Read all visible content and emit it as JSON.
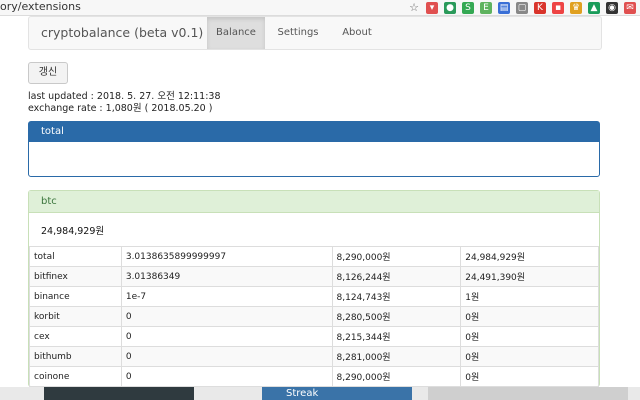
{
  "browser": {
    "url_fragment": "ory/extensions",
    "icons": [
      {
        "name": "star-icon",
        "color": "#666666",
        "glyph": "☆"
      },
      {
        "name": "pocket-icon",
        "color": "#e05050",
        "glyph": "▾"
      },
      {
        "name": "chat-icon",
        "color": "#2a9a5a",
        "glyph": "●"
      },
      {
        "name": "extension-icon",
        "color": "#34a853",
        "glyph": "S"
      },
      {
        "name": "evernote-icon",
        "color": "#5fb35f",
        "glyph": "E"
      },
      {
        "name": "doc-icon",
        "color": "#3a6fd6",
        "glyph": "▤"
      },
      {
        "name": "outline-icon",
        "color": "#888888",
        "glyph": "▢"
      },
      {
        "name": "k-icon",
        "color": "#d9342b",
        "glyph": "K"
      },
      {
        "name": "red-block-icon",
        "color": "#e44",
        "glyph": "▪"
      },
      {
        "name": "crown-icon",
        "color": "#e0a020",
        "glyph": "♛"
      },
      {
        "name": "drive-icon",
        "color": "#1a9c5a",
        "glyph": "▲"
      },
      {
        "name": "github-icon",
        "color": "#333333",
        "glyph": "◉"
      },
      {
        "name": "mail-icon",
        "color": "#e05050",
        "glyph": "✉"
      }
    ]
  },
  "navbar": {
    "brand": "cryptobalance (beta v0.1)",
    "tabs": [
      {
        "label": "Balance",
        "active": true
      },
      {
        "label": "Settings",
        "active": false
      },
      {
        "label": "About",
        "active": false
      }
    ]
  },
  "refresh_label": "갱신",
  "last_updated": "last updated : 2018. 5. 27. 오전 12:11:38",
  "exchange_rate": "exchange rate : 1,080원 ( 2018.05.20 )",
  "total_panel": {
    "title": "total"
  },
  "btc_panel": {
    "title": "btc",
    "sum": "24,984,929원",
    "rows": [
      {
        "exchange": "total",
        "amount": "3.0138635899999997",
        "price": "8,290,000원",
        "value": "24,984,929원"
      },
      {
        "exchange": "bitfinex",
        "amount": "3.01386349",
        "price": "8,126,244원",
        "value": "24,491,390원"
      },
      {
        "exchange": "binance",
        "amount": "1e-7",
        "price": "8,124,743원",
        "value": "1원"
      },
      {
        "exchange": "korbit",
        "amount": "0",
        "price": "8,280,500원",
        "value": "0원"
      },
      {
        "exchange": "cex",
        "amount": "0",
        "price": "8,215,344원",
        "value": "0원"
      },
      {
        "exchange": "bithumb",
        "amount": "0",
        "price": "8,281,000원",
        "value": "0원"
      },
      {
        "exchange": "coinone",
        "amount": "0",
        "price": "8,290,000원",
        "value": "0원"
      }
    ]
  },
  "background_page": {
    "tile_label": "Streak"
  }
}
